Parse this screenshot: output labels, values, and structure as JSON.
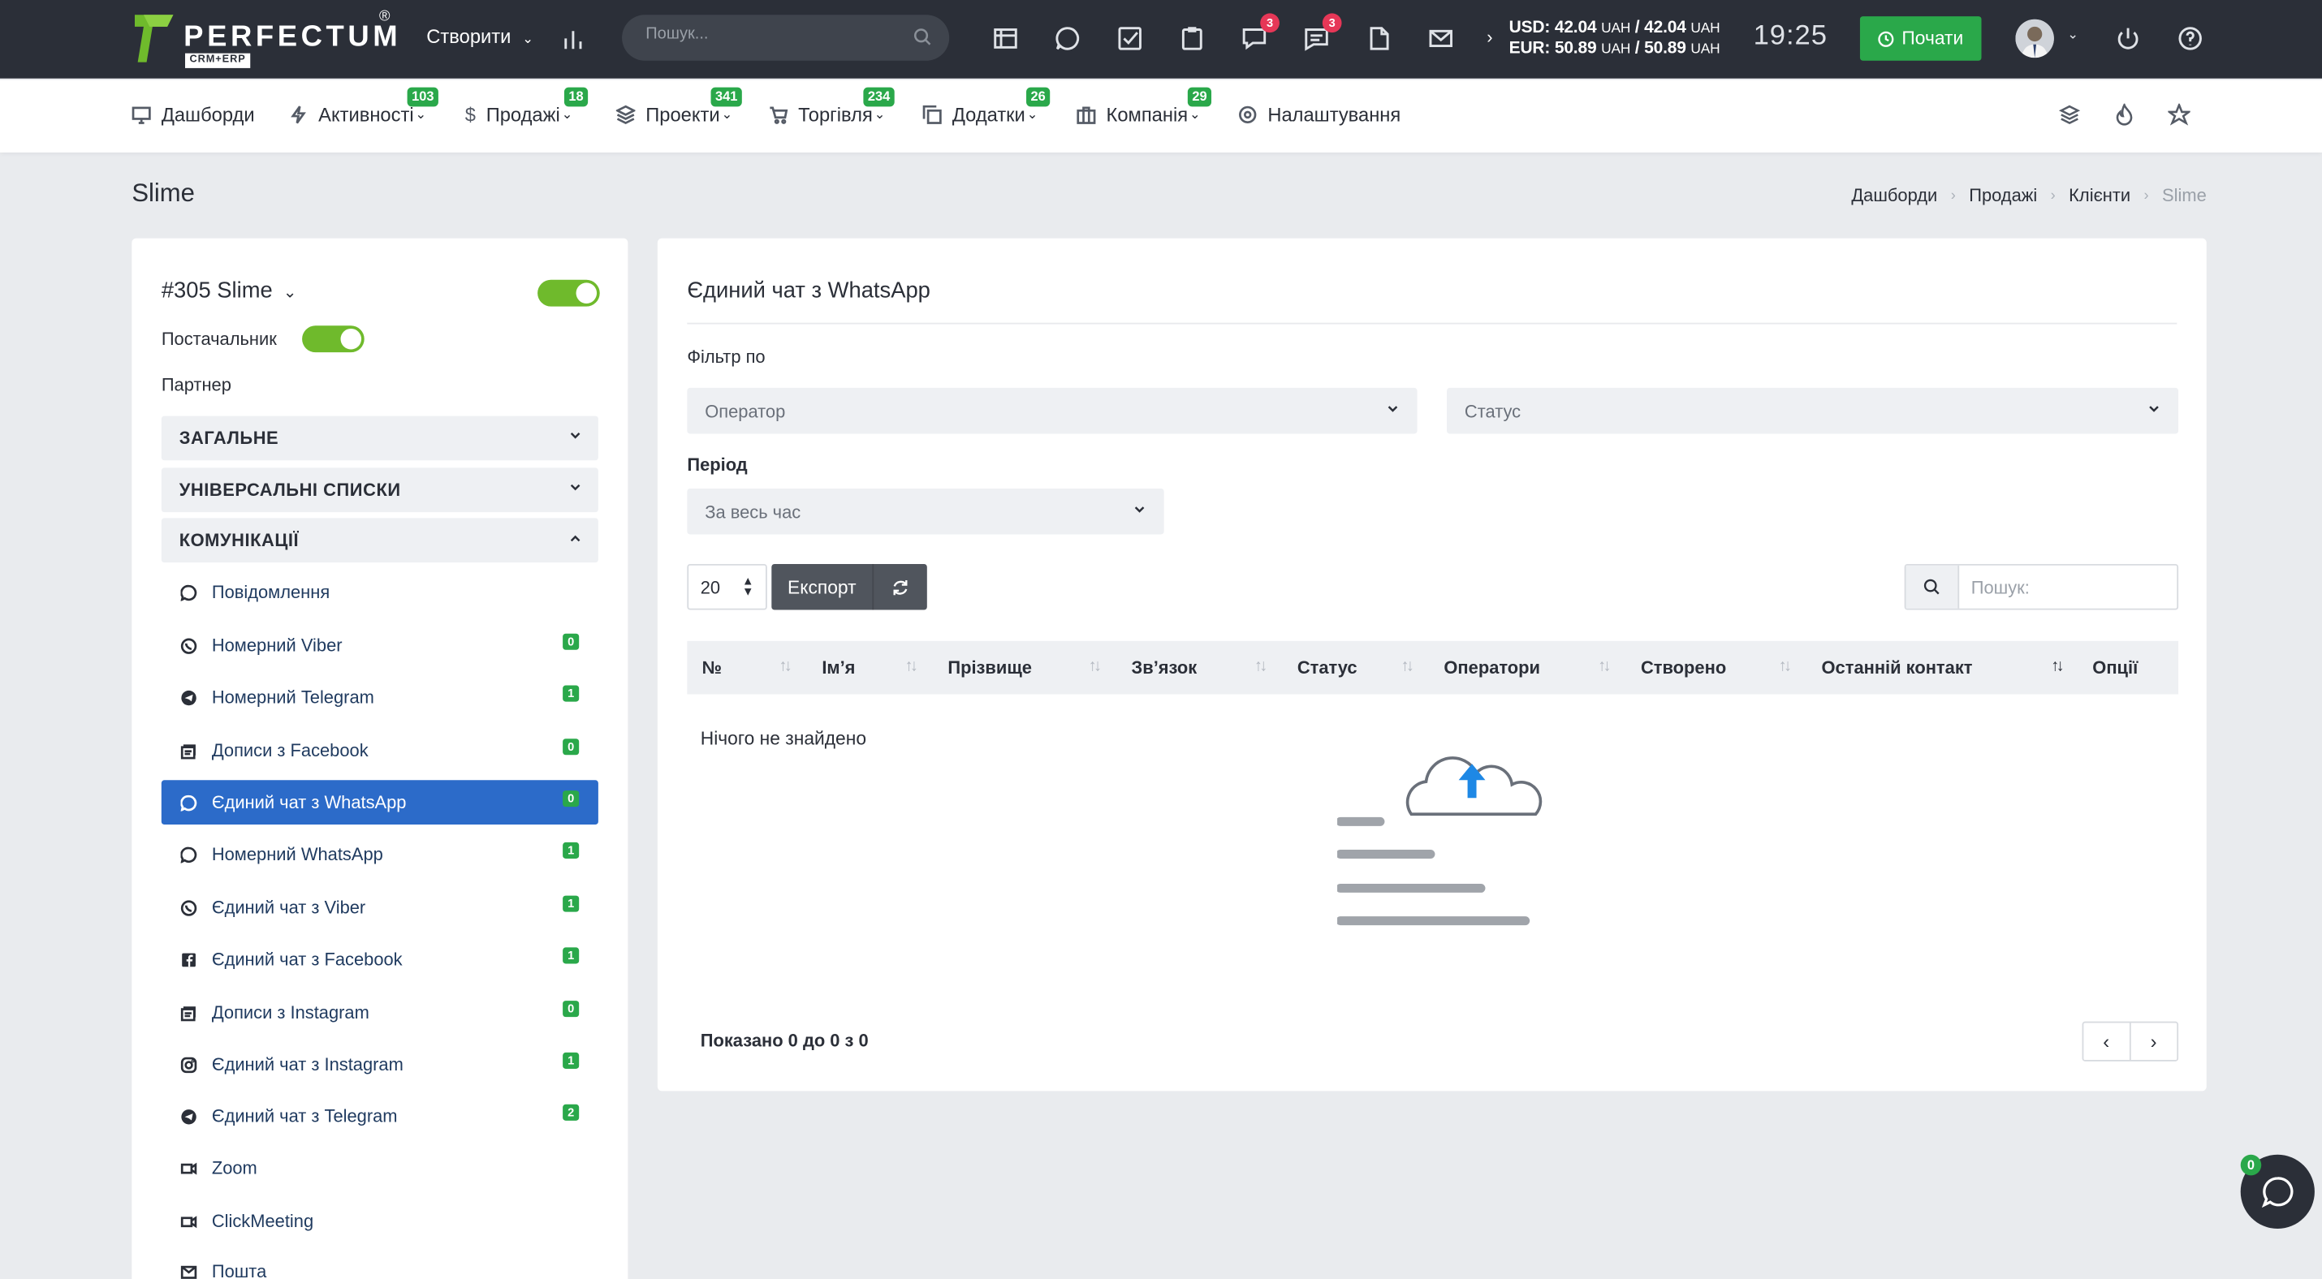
{
  "topbar": {
    "logo_text": "PERFECTUM",
    "logo_sub": "CRM+ERP",
    "logo_reg": "®",
    "create_label": "Створити",
    "search_placeholder": "Пошук...",
    "notification_badges": {
      "tasks_chat": "3",
      "messages": "3"
    },
    "usd_label": "USD: 42.04",
    "usd_unit1": "UAH",
    "usd_sep": " / 42.04",
    "usd_unit2": "UAH",
    "eur_label": "EUR: 50.89",
    "eur_unit1": "UAH",
    "eur_sep": " / 50.89",
    "eur_unit2": "UAH",
    "clock": "19:25",
    "start_button": "Почати"
  },
  "nav": {
    "items": [
      {
        "label": "Дашборди",
        "icon": "monitor-icon",
        "badge": ""
      },
      {
        "label": "Активності",
        "icon": "bolt-icon",
        "badge": "103"
      },
      {
        "label": "Продажі",
        "icon": "dollar-icon",
        "badge": "18"
      },
      {
        "label": "Проекти",
        "icon": "layers-icon",
        "badge": "341"
      },
      {
        "label": "Торгівля",
        "icon": "cart-icon",
        "badge": "234"
      },
      {
        "label": "Додатки",
        "icon": "copy-icon",
        "badge": "26"
      },
      {
        "label": "Компанія",
        "icon": "briefcase-icon",
        "badge": "29"
      },
      {
        "label": "Налаштування",
        "icon": "gear-icon",
        "badge": ""
      }
    ]
  },
  "page": {
    "title": "Slime",
    "breadcrumb": [
      "Дашборди",
      "Продажі",
      "Клієнти",
      "Slime"
    ]
  },
  "left": {
    "client_title": "#305 Slime",
    "supplier_label": "Постачальник",
    "partner_label": "Партнер",
    "sections": [
      "ЗАГАЛЬНЕ",
      "УНІВЕРСАЛЬНІ СПИСКИ",
      "КОМУНІКАЦІЇ"
    ],
    "items": [
      {
        "label": "Повідомлення",
        "icon": "chat-bubble-icon",
        "count": ""
      },
      {
        "label": "Номерний Viber",
        "icon": "viber-icon",
        "count": "0"
      },
      {
        "label": "Номерний Telegram",
        "icon": "telegram-icon",
        "count": "1"
      },
      {
        "label": "Дописи з Facebook",
        "icon": "facebook-posts-icon",
        "count": "0"
      },
      {
        "label": "Єдиний чат з WhatsApp",
        "icon": "whatsapp-icon",
        "count": "0"
      },
      {
        "label": "Номерний WhatsApp",
        "icon": "whatsapp-icon",
        "count": "1"
      },
      {
        "label": "Єдиний чат з Viber",
        "icon": "viber-icon",
        "count": "1"
      },
      {
        "label": "Єдиний чат з Facebook",
        "icon": "facebook-icon",
        "count": "1"
      },
      {
        "label": "Дописи з Instagram",
        "icon": "instagram-posts-icon",
        "count": "0"
      },
      {
        "label": "Єдиний чат з Instagram",
        "icon": "instagram-icon",
        "count": "1"
      },
      {
        "label": "Єдиний чат з Telegram",
        "icon": "telegram-icon",
        "count": "2"
      },
      {
        "label": "Zoom",
        "icon": "video-icon",
        "count": ""
      },
      {
        "label": "ClickMeeting",
        "icon": "video-icon",
        "count": ""
      },
      {
        "label": "Пошта",
        "icon": "mail-icon",
        "count": ""
      }
    ]
  },
  "main": {
    "title": "Єдиний чат з WhatsApp",
    "filter_label": "Фільтр по",
    "operator_select": "Оператор",
    "status_select": "Статус",
    "period_label": "Період",
    "period_select": "За весь час",
    "per_page": "20",
    "export_label": "Експорт",
    "search_placeholder": "Пошук:",
    "columns": [
      "№",
      "Ім’я",
      "Прізвище",
      "Зв’язок",
      "Статус",
      "Оператори",
      "Створено",
      "Останній контакт",
      "Опції"
    ],
    "empty_text": "Нічого не знайдено",
    "showing_text": "Показано 0 до 0 з 0"
  },
  "chat_fab": {
    "count": "0"
  },
  "colors": {
    "topbar": "#2b2f38",
    "accent_green": "#2aa84a",
    "active_blue": "#2c6bc9",
    "badge_red": "#e63757"
  }
}
